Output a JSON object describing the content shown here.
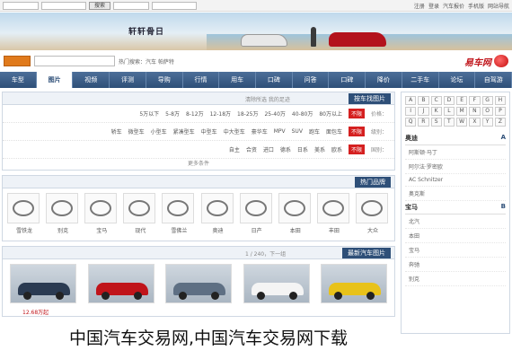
{
  "topbar": {
    "search_label": "搜索",
    "links": [
      "注册",
      "登录",
      "汽车报价",
      "手机版",
      "网站导航"
    ]
  },
  "banner": {
    "title": "轩轩骨日",
    "colors": {
      "car1": "#e8e8e8",
      "car2": "#b3121c"
    }
  },
  "search": {
    "button_label": "搜索",
    "hot_text": "热门搜索：汽车  帕萨特",
    "logo_text": "易车网"
  },
  "nav": {
    "items": [
      "车型",
      "图片",
      "视频",
      "评测",
      "导购",
      "行情",
      "用车",
      "口碑",
      "问答",
      "口碑",
      "降价",
      "二手车",
      "论坛",
      "自驾游"
    ],
    "active_index": 1
  },
  "filter": {
    "title": "按车找图片",
    "side_text": "清除所选  我的足迹",
    "price_label": "价格：",
    "price_tag": "不限",
    "prices": [
      "5万以下",
      "5-8万",
      "8-12万",
      "12-18万",
      "18-25万",
      "25-40万",
      "40-80万",
      "80万以上"
    ],
    "level_label": "级别：",
    "level_tag": "不限",
    "levels": [
      "轿车",
      "微型车",
      "小型车",
      "紧凑型车",
      "中型车",
      "中大型车",
      "豪华车",
      "MPV",
      "SUV",
      "跑车",
      "面包车"
    ],
    "country_label": "国别：",
    "country_tag": "不限",
    "countries": [
      "自主",
      "合资",
      "进口",
      "德系",
      "日系",
      "美系",
      "欧系"
    ],
    "more_label": "更多条件"
  },
  "brands": {
    "title": "热门品牌",
    "items": [
      {
        "name": "雪铁龙",
        "icon": "citroen-logo-icon"
      },
      {
        "name": "别克",
        "icon": "buick-logo-icon"
      },
      {
        "name": "宝马",
        "icon": "bmw-logo-icon"
      },
      {
        "name": "现代",
        "icon": "hyundai-logo-icon"
      },
      {
        "name": "雪佛兰",
        "icon": "chevrolet-logo-icon"
      },
      {
        "name": "奥迪",
        "icon": "audi-logo-icon"
      },
      {
        "name": "日产",
        "icon": "nissan-logo-icon"
      },
      {
        "name": "本田",
        "icon": "honda-logo-icon"
      },
      {
        "name": "丰田",
        "icon": "toyota-logo-icon"
      },
      {
        "name": "大众",
        "icon": "vw-logo-icon"
      }
    ]
  },
  "cars": {
    "title": "最新汽车图片",
    "count_text": "1 / 240，下一组",
    "items": [
      {
        "color": "#2b3b52"
      },
      {
        "color": "#c0141a"
      },
      {
        "color": "#5e6f83"
      },
      {
        "color": "#f4f4f4"
      },
      {
        "color": "#e8c21a"
      }
    ],
    "price_text": "12.68万起"
  },
  "sidebar": {
    "letters": [
      "A",
      "B",
      "C",
      "D",
      "E",
      "F",
      "G",
      "H",
      "I",
      "J",
      "K",
      "L",
      "M",
      "N",
      "O",
      "P",
      "Q",
      "R",
      "S",
      "T",
      "W",
      "X",
      "Y",
      "Z"
    ],
    "groups": [
      {
        "letter": "A",
        "name": "奥迪",
        "items": [
          "阿斯顿·马丁",
          "阿尔法·罗密欧",
          "AC Schnitzer",
          "奥克斯"
        ]
      },
      {
        "letter": "B",
        "name": "宝马",
        "items": [
          "北汽",
          "本田",
          "宝马",
          "奔驰",
          "别克"
        ]
      }
    ]
  },
  "caption": "中国汽车交易网,中国汽车交易网下载"
}
